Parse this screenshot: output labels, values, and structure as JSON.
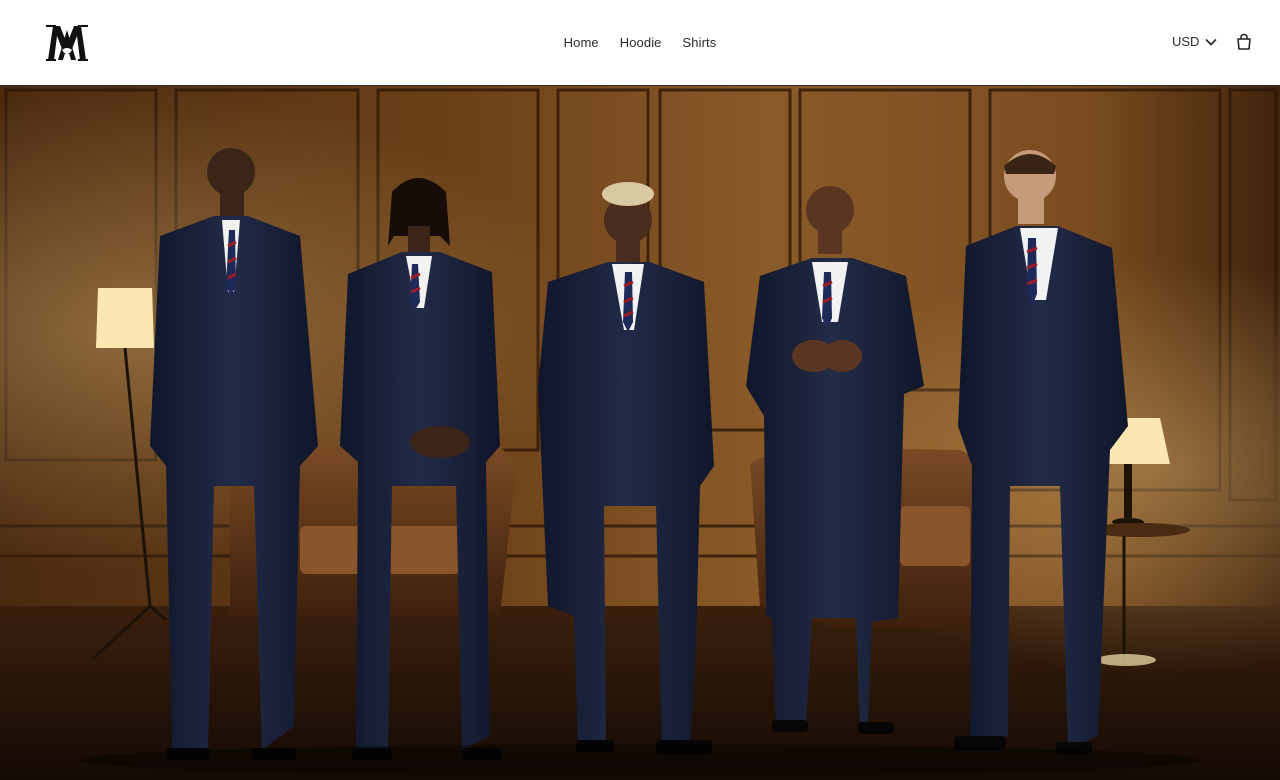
{
  "brand": {
    "logo_text": "AM",
    "logo_icon": "am-monogram-logo"
  },
  "nav": {
    "items": [
      {
        "label": "Home"
      },
      {
        "label": "Hoodie"
      },
      {
        "label": "Shirts"
      }
    ]
  },
  "header_right": {
    "currency_label": "USD",
    "currency_icon": "chevron-down-icon",
    "cart_icon": "shopping-bag-icon"
  },
  "hero": {
    "image_description_icon": "hero-campaign-photo",
    "colors": {
      "wall": "#7a4a1f",
      "floor": "#2a1608",
      "suit": "#1a2238",
      "shirt": "#f2f2f2",
      "tie_stripe_red": "#9b1c26",
      "lamp_glow": "#fbe7b0"
    }
  }
}
